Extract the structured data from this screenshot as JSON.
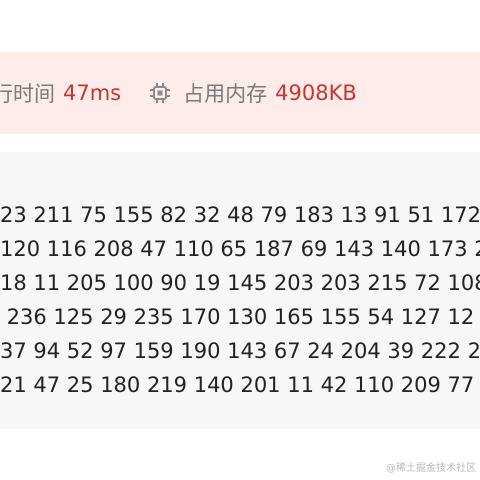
{
  "stats": {
    "time_label": "行时间",
    "time_value": "47ms",
    "memory_icon": "chip-icon",
    "memory_label": "占用内存",
    "memory_value": "4908KB"
  },
  "output": {
    "lines": [
      "23 211 75 155 82 32 48 79 183 13 91 51 172",
      "120 116 208 47 110 65 187 69 143 140 173 2",
      "18 11 205 100 90 19 145 203 203 215 72 108",
      " 236 125 29 235 170 130 165 155 54 127 12",
      "37 94 52 97 159 190 143 67 24 204 39 222 2",
      "21 47 25 180 219 140 201 11 42 110 209 77"
    ]
  },
  "watermark": "@稀土掘金技术社区",
  "colors": {
    "stats_background": "#fdecea",
    "value_red": "#d0312d",
    "output_background": "#f7f7f7"
  }
}
